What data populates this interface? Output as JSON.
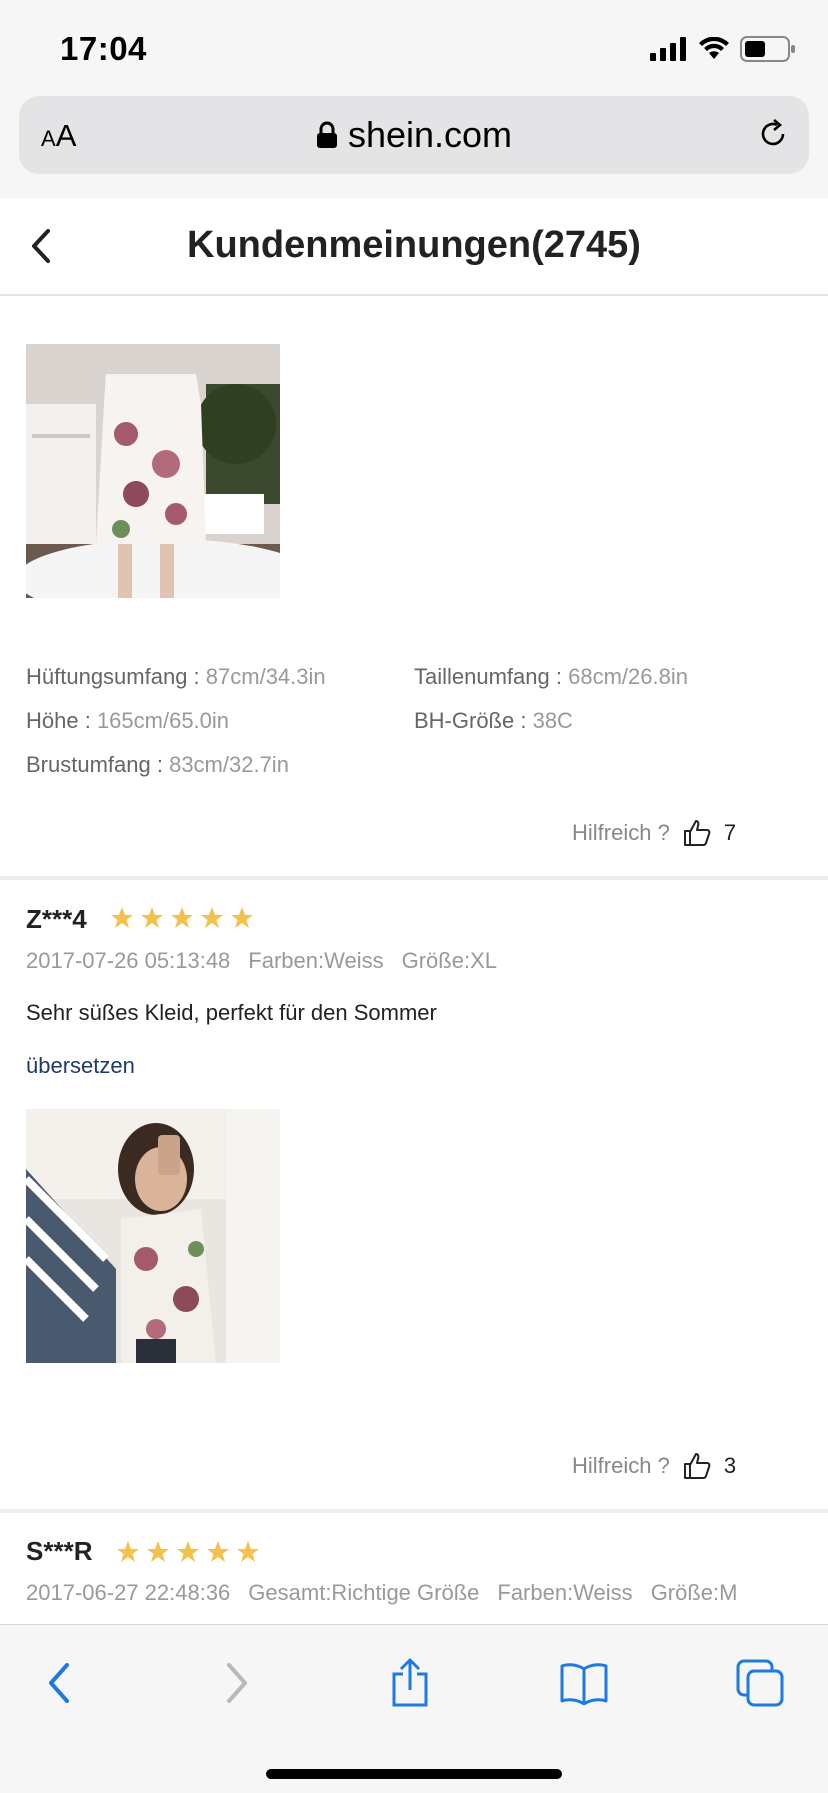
{
  "status": {
    "time": "17:04"
  },
  "browser": {
    "aa_small": "A",
    "aa_large": "A",
    "domain": "shein.com"
  },
  "header": {
    "title": "Kundenmeinungen(2745)"
  },
  "review1": {
    "measurements": [
      {
        "label": "Hüftungsumfang : ",
        "value": "87cm/34.3in"
      },
      {
        "label": "Taillenumfang : ",
        "value": "68cm/26.8in"
      },
      {
        "label": "Höhe : ",
        "value": "165cm/65.0in"
      },
      {
        "label": "BH-Größe : ",
        "value": "38C"
      },
      {
        "label": "Brustumfang : ",
        "value": "83cm/32.7in"
      }
    ],
    "helpful_label": "Hilfreich ?",
    "helpful_count": "7"
  },
  "review2": {
    "name": "Z***4",
    "rating": 5,
    "date": "2017-07-26 05:13:48",
    "color": "Farben:Weiss",
    "size": "Größe:XL",
    "comment": "Sehr süßes Kleid, perfekt für den Sommer",
    "translate_label": "übersetzen",
    "helpful_label": "Hilfreich ?",
    "helpful_count": "3"
  },
  "review3": {
    "name": "S***R",
    "rating": 5,
    "date": "2017-06-27 22:48:36",
    "fit": "Gesamt:Richtige Größe",
    "color": "Farben:Weiss",
    "size": "Größe:M"
  },
  "icons": {
    "star_color": "#f2c14e",
    "accent": "#1f7ae0",
    "link_color": "#1f3a6b"
  }
}
